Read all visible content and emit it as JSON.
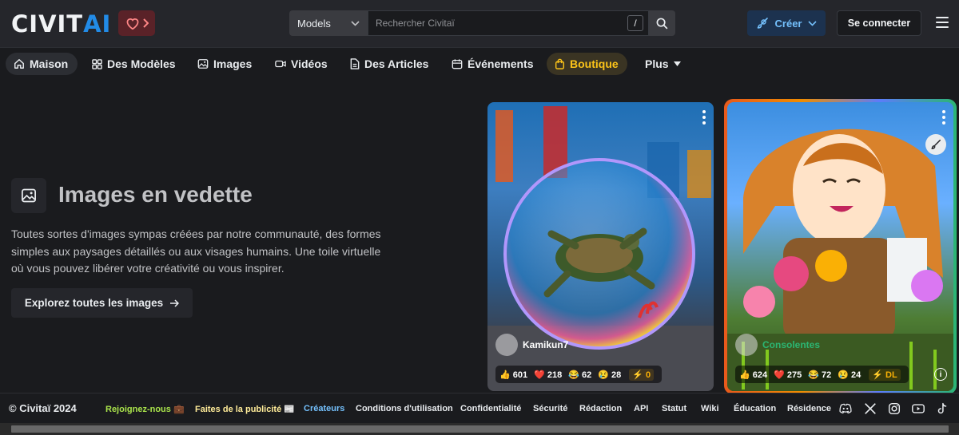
{
  "header": {
    "logo_part1": "CIVIT",
    "logo_part2": "AI",
    "search_category": "Models",
    "search_placeholder": "Rechercher Civitaï",
    "search_shortcut": "/",
    "create_label": "Créer",
    "login_label": "Se connecter"
  },
  "nav": {
    "items": [
      {
        "label": "Maison",
        "icon": "home-icon"
      },
      {
        "label": "Des Modèles",
        "icon": "grid-icon"
      },
      {
        "label": "Images",
        "icon": "photo-icon"
      },
      {
        "label": "Vidéos",
        "icon": "video-icon"
      },
      {
        "label": "Des Articles",
        "icon": "file-icon"
      },
      {
        "label": "Événements",
        "icon": "calendar-icon"
      },
      {
        "label": "Boutique",
        "icon": "shopping-bag-icon"
      },
      {
        "label": "Plus",
        "icon": "caret-down-icon"
      }
    ]
  },
  "hero": {
    "title": "Images en vedette",
    "description": "Toutes sortes d'images sympas créées par notre communauté, des formes simples aux paysages détaillés ou aux visages humains. Une toile virtuelle où vous pouvez libérer votre créativité ou vous inspirer.",
    "explore_label": "Explorez toutes les images"
  },
  "cards": [
    {
      "user": "Kamikun7",
      "likes": "601",
      "hearts": "218",
      "laughs": "62",
      "cries": "28",
      "buzz": "0"
    },
    {
      "user": "Consolentes",
      "likes": "624",
      "hearts": "275",
      "laughs": "72",
      "cries": "24",
      "buzz": "DL"
    }
  ],
  "footer": {
    "copyright": "© Civitaï 2024",
    "links": [
      "Rejoignez-nous 💼",
      "Faites de la publicité 📰",
      "Créateurs",
      "Conditions d'utilisation",
      "Confidentialité",
      "Sécurité",
      "Rédaction",
      "API",
      "Statut",
      "Wiki",
      "Éducation",
      "Résidence"
    ]
  },
  "colors": {
    "accent": "#228be6",
    "shop": "#fcc419",
    "join": "#a9e34b",
    "ads": "#ffec99",
    "creators": "#74c0fc"
  }
}
